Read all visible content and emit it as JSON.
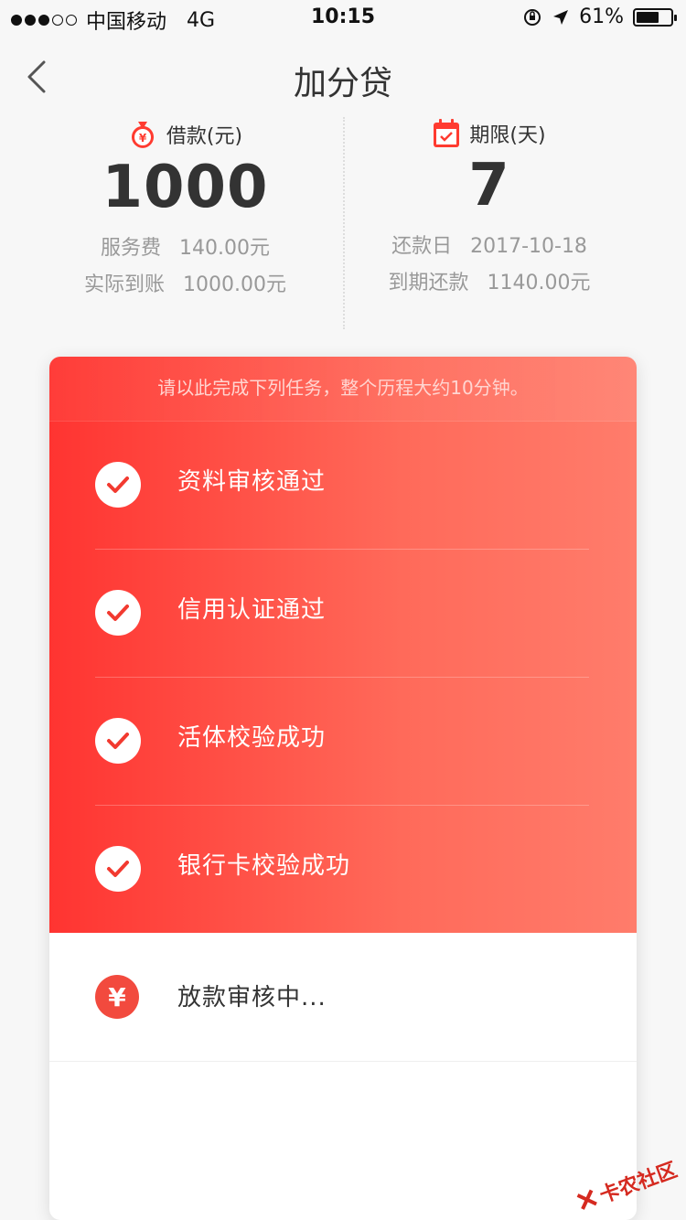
{
  "status_bar": {
    "carrier": "中国移动",
    "network": "4G",
    "time": "10:15",
    "battery": "61%"
  },
  "nav": {
    "title": "加分贷"
  },
  "loan": {
    "amount_label": "借款(元)",
    "amount_value": "1000",
    "fee_label": "服务费",
    "fee_value": "140.00元",
    "actual_label": "实际到账",
    "actual_value": "1000.00元"
  },
  "term": {
    "label": "期限(天)",
    "value": "7",
    "repay_date_label": "还款日",
    "repay_date_value": "2017-10-18",
    "due_label": "到期还款",
    "due_value": "1140.00元"
  },
  "card": {
    "note": "请以此完成下列任务，整个历程大约10分钟。",
    "tasks": [
      {
        "label": "资料审核通过"
      },
      {
        "label": "信用认证通过"
      },
      {
        "label": "活体校验成功"
      },
      {
        "label": "银行卡校验成功"
      }
    ],
    "pending": {
      "label": "放款审核中..."
    }
  },
  "watermark": {
    "text": "卡农社区"
  },
  "colors": {
    "accent": "#ff3431",
    "accent_end": "#ff7c6b",
    "text": "#333333",
    "muted": "#999999"
  }
}
